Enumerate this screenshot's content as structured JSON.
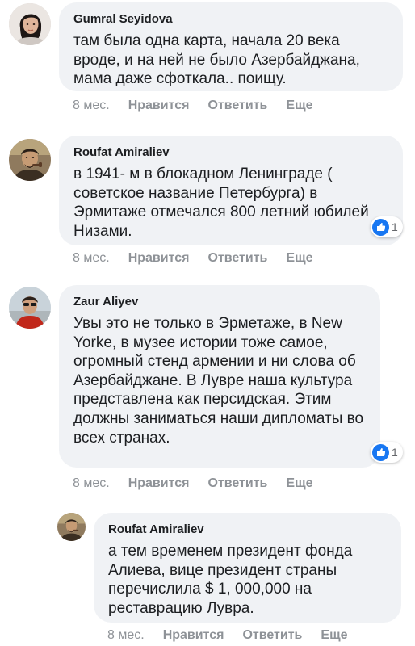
{
  "accent": "#1877f2",
  "comments": [
    {
      "author": "Gumral Seyidova",
      "text": "там была одна карта, начала 20 века вроде, и на ней не было Азербайджана, мама даже сфоткала.. поищу.",
      "time": "8 мес.",
      "like": "Нравится",
      "reply": "Ответить",
      "more": "Еще",
      "reactions": null
    },
    {
      "author": "Roufat Amiraliev",
      "text": "в 1941- м в блокадном Ленинграде ( советское название Петербурга) в Эрмитаже отмечался 800 летний юбилей Низами.",
      "time": "8 мес.",
      "like": "Нравится",
      "reply": "Ответить",
      "more": "Еще",
      "reactions": "1"
    },
    {
      "author": "Zaur Aliyev",
      "text": "Увы это не только в Эрметаже, в New Yorke, в музее истории тоже самое, огромный стенд армении и ни слова об Азербайджане. В Лувре наша культура представлена как персидская. Этим должны заниматься наши дипломаты во всех странах.",
      "time": "8 мес.",
      "like": "Нравится",
      "reply": "Ответить",
      "more": "Еще",
      "reactions": "1"
    },
    {
      "author": "Roufat Amiraliev",
      "text": "а тем временем президент фонда Алиева, вице президент страны перечислила $ 1, 000,000 на реставрацию Лувра.",
      "time": "8 мес.",
      "like": "Нравится",
      "reply": "Ответить",
      "more": "Еще",
      "reactions": null
    }
  ]
}
